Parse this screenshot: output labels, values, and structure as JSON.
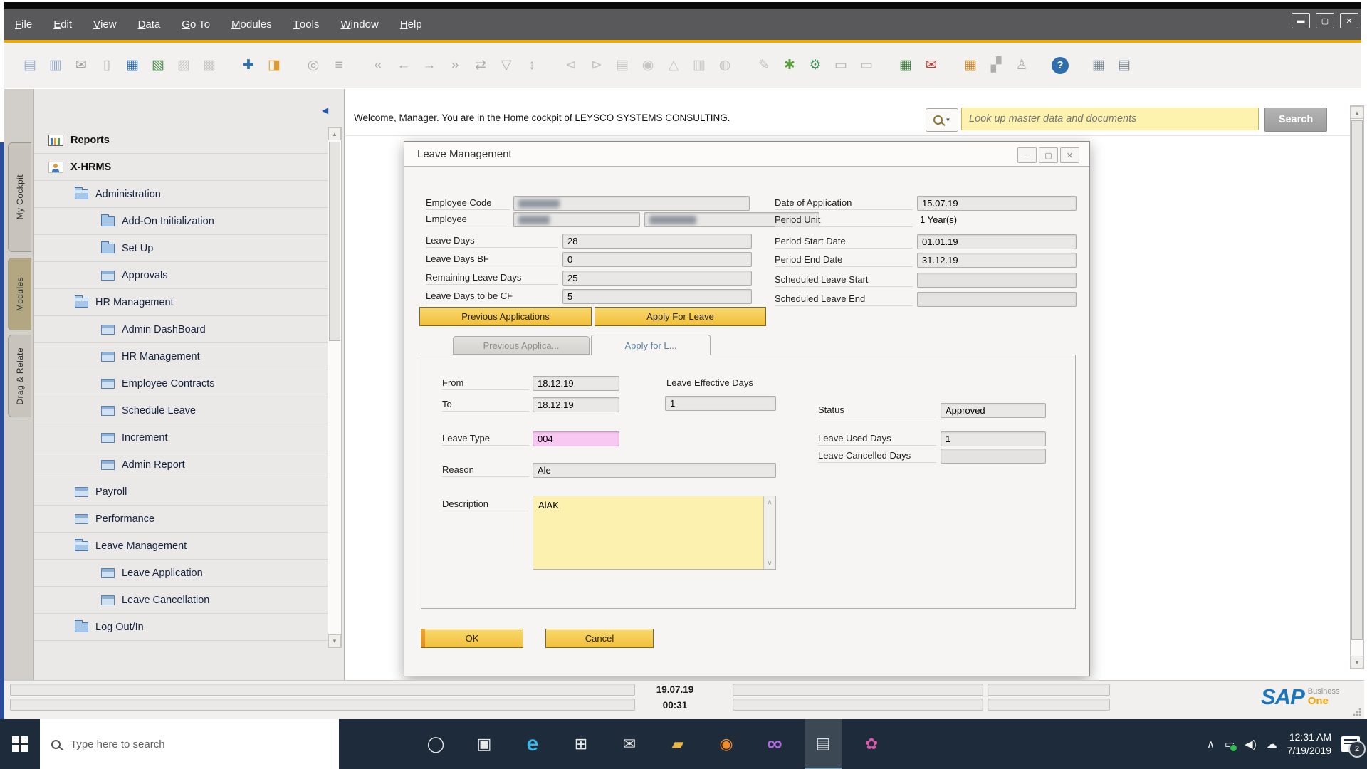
{
  "colors": {
    "accent_gold": "#F0AB00",
    "sap_blue": "#1B74BC",
    "sap_one_orange": "#F0A500",
    "leave_type_pink": "#F9C8F2",
    "description_yellow": "#FCF1AE",
    "search_yellow": "#FDF2AE",
    "menubar_gray": "#59595B",
    "taskbar_navy": "#1E2B3A"
  },
  "menu_bar": {
    "items": [
      {
        "label": "File"
      },
      {
        "label": "Edit"
      },
      {
        "label": "View"
      },
      {
        "label": "Data"
      },
      {
        "label": "Go To"
      },
      {
        "label": "Modules"
      },
      {
        "label": "Tools"
      },
      {
        "label": "Window"
      },
      {
        "label": "Help"
      }
    ]
  },
  "window_controls": {
    "minimize": "▬",
    "restore": "▢",
    "close": "✕"
  },
  "toolbar": {
    "icons": [
      {
        "name": "print-preview",
        "glyph": "▤",
        "color": "#9ab0cc"
      },
      {
        "name": "print",
        "glyph": "▥",
        "color": "#8aa0bc"
      },
      {
        "name": "email",
        "glyph": "✉",
        "color": "#a8a6a2"
      },
      {
        "name": "copy-document",
        "glyph": "▯",
        "color": "#b8b6b2"
      },
      {
        "name": "fax",
        "glyph": "▦",
        "color": "#2f6fae"
      },
      {
        "name": "export-excel",
        "glyph": "▧",
        "color": "#4e8f4e"
      },
      {
        "name": "export-word",
        "glyph": "▨",
        "color": "#c6c4c0"
      },
      {
        "name": "export-pdf",
        "glyph": "▩",
        "color": "#c6c4c0"
      },
      {
        "name": "navigation-arrows",
        "glyph": "✚",
        "color": "#2f6fae",
        "gap": true
      },
      {
        "name": "lock-screen",
        "glyph": "◨",
        "color": "#e09a2f"
      },
      {
        "name": "find",
        "glyph": "◎",
        "color": "#b0aeaa",
        "gap": true
      },
      {
        "name": "list-view",
        "glyph": "≡",
        "color": "#b0aeaa"
      },
      {
        "name": "first-record",
        "glyph": "«",
        "color": "#b0aeaa",
        "gap": true
      },
      {
        "name": "previous-record",
        "glyph": "←",
        "color": "#b0aeaa"
      },
      {
        "name": "next-record",
        "glyph": "→",
        "color": "#b0aeaa"
      },
      {
        "name": "last-record",
        "glyph": "»",
        "color": "#b0aeaa"
      },
      {
        "name": "refresh",
        "glyph": "⇄",
        "color": "#b0aeaa"
      },
      {
        "name": "filter",
        "glyph": "▽",
        "color": "#b0aeaa"
      },
      {
        "name": "sort",
        "glyph": "↕",
        "color": "#b0aeaa"
      },
      {
        "name": "copy-from",
        "glyph": "⊲",
        "color": "#c6c4c0",
        "gap": true
      },
      {
        "name": "copy-to",
        "glyph": "⊳",
        "color": "#c6c4c0"
      },
      {
        "name": "payment-means",
        "glyph": "▤",
        "color": "#c6c4c0"
      },
      {
        "name": "money-functions",
        "glyph": "◉",
        "color": "#c6c4c0"
      },
      {
        "name": "volume-weight",
        "glyph": "△",
        "color": "#c6c4c0"
      },
      {
        "name": "journal-entry",
        "glyph": "▥",
        "color": "#c6c4c0"
      },
      {
        "name": "document-search",
        "glyph": "◍",
        "color": "#c6c4c0"
      },
      {
        "name": "edit",
        "glyph": "✎",
        "color": "#c6c4c0",
        "gap": true
      },
      {
        "name": "new-activity",
        "glyph": "✱",
        "color": "#5a9e3f"
      },
      {
        "name": "settings-wrench",
        "glyph": "⚙",
        "color": "#3f8f5a"
      },
      {
        "name": "remarks",
        "glyph": "▭",
        "color": "#b0aeaa"
      },
      {
        "name": "delivery-note",
        "glyph": "▭",
        "color": "#b0aeaa"
      },
      {
        "name": "checklist",
        "glyph": "▦",
        "color": "#3f7d3f",
        "gap": true
      },
      {
        "name": "mail-alert",
        "glyph": "✉",
        "color": "#c03a2f"
      },
      {
        "name": "report-designer",
        "glyph": "▦",
        "color": "#c98a2f",
        "gap": true
      },
      {
        "name": "org-chart",
        "glyph": "▞",
        "color": "#b0aeaa"
      },
      {
        "name": "user",
        "glyph": "♙",
        "color": "#b0aeaa"
      },
      {
        "name": "help",
        "glyph": "?",
        "color": "#2f6fae",
        "circle": true,
        "gap": true
      },
      {
        "name": "calculator",
        "glyph": "▦",
        "color": "#7a8894",
        "gap": true
      },
      {
        "name": "keyboard-calc",
        "glyph": "▤",
        "color": "#7a8894"
      }
    ]
  },
  "sidebar": {
    "tabs": [
      {
        "label": "My Cockpit"
      },
      {
        "label": "Modules"
      },
      {
        "label": "Drag & Relate"
      }
    ],
    "tree": [
      {
        "label": "Reports",
        "icon": "chart",
        "level": 0,
        "bold": true
      },
      {
        "label": "X-HRMS",
        "icon": "person",
        "level": 0,
        "bold": true
      },
      {
        "label": "Administration",
        "icon": "folder-open",
        "level": 1,
        "bold": false
      },
      {
        "label": "Add-On Initialization",
        "icon": "folder",
        "level": 2,
        "bold": false
      },
      {
        "label": "Set Up",
        "icon": "folder",
        "level": 2,
        "bold": false
      },
      {
        "label": "Approvals",
        "icon": "window",
        "level": 2,
        "bold": false
      },
      {
        "label": "HR Management",
        "icon": "folder-open",
        "level": 1,
        "bold": false
      },
      {
        "label": "Admin DashBoard",
        "icon": "window",
        "level": 2,
        "bold": false
      },
      {
        "label": "HR Management",
        "icon": "window",
        "level": 2,
        "bold": false
      },
      {
        "label": "Employee Contracts",
        "icon": "window",
        "level": 2,
        "bold": false
      },
      {
        "label": "Schedule Leave",
        "icon": "window",
        "level": 2,
        "bold": false
      },
      {
        "label": "Increment",
        "icon": "window",
        "level": 2,
        "bold": false
      },
      {
        "label": "Admin Report",
        "icon": "window",
        "level": 2,
        "bold": false
      },
      {
        "label": "Payroll",
        "icon": "window",
        "level": 1,
        "bold": false
      },
      {
        "label": "Performance",
        "icon": "window",
        "level": 1,
        "bold": false
      },
      {
        "label": "Leave Management",
        "icon": "folder-open",
        "level": 1,
        "bold": false
      },
      {
        "label": "Leave Application",
        "icon": "window",
        "level": 2,
        "bold": false
      },
      {
        "label": "Leave Cancellation",
        "icon": "window",
        "level": 2,
        "bold": false
      },
      {
        "label": "Log Out/In",
        "icon": "folder",
        "level": 1,
        "bold": false
      }
    ]
  },
  "content": {
    "welcome_text": "Welcome, Manager. You are in the Home cockpit of LEYSCO SYSTEMS CONSULTING.",
    "search": {
      "placeholder": "Look up master data and documents",
      "button_label": "Search"
    }
  },
  "dialog": {
    "title": "Leave Management",
    "fields": {
      "employee_code_label": "Employee Code",
      "employee_label": "Employee",
      "leave_days_label": "Leave Days",
      "leave_days_value": "28",
      "leave_days_bf_label": "Leave Days BF",
      "leave_days_bf_value": "0",
      "remaining_leave_days_label": "Remaining Leave Days",
      "remaining_leave_days_value": "25",
      "leave_days_cf_label": "Leave Days to be CF",
      "leave_days_cf_value": "5",
      "date_of_application_label": "Date of Application",
      "date_of_application_value": "15.07.19",
      "period_unit_label": "Period Unit",
      "period_unit_value": "1 Year(s)",
      "period_start_label": "Period Start Date",
      "period_start_value": "01.01.19",
      "period_end_label": "Period End Date",
      "period_end_value": "31.12.19",
      "scheduled_start_label": "Scheduled Leave Start",
      "scheduled_start_value": "",
      "scheduled_end_label": "Scheduled Leave End",
      "scheduled_end_value": ""
    },
    "action_buttons": {
      "previous_applications": "Previous Applications",
      "apply_for_leave": "Apply For Leave"
    },
    "tabs": {
      "previous": "Previous Applica...",
      "apply": "Apply for L..."
    },
    "form": {
      "from_label": "From",
      "from_value": "18.12.19",
      "to_label": "To",
      "to_value": "18.12.19",
      "leave_effective_days_label": "Leave Effective Days",
      "leave_effective_days_value": "1",
      "leave_type_label": "Leave Type",
      "leave_type_value": "004",
      "reason_label": "Reason",
      "reason_value": "Ale",
      "description_label": "Description",
      "description_value": "AlAK",
      "status_label": "Status",
      "status_value": "Approved",
      "leave_used_days_label": "Leave Used Days",
      "leave_used_days_value": "1",
      "leave_cancelled_days_label": "Leave Cancelled Days",
      "leave_cancelled_days_value": ""
    },
    "footer_buttons": {
      "ok": "OK",
      "cancel": "Cancel"
    }
  },
  "status_bar": {
    "date": "19.07.19",
    "time": "00:31",
    "sap_logo": {
      "sap": "SAP",
      "business": "Business",
      "one": "One"
    }
  },
  "taskbar": {
    "search_placeholder": "Type here to search",
    "apps": [
      {
        "name": "cortana",
        "glyph": "◯",
        "color": "#e8e8e8"
      },
      {
        "name": "task-view",
        "glyph": "▣",
        "color": "#e8e8e8"
      },
      {
        "name": "edge",
        "glyph": "e",
        "color": "#3fb6e8",
        "big": true
      },
      {
        "name": "store",
        "glyph": "⊞",
        "color": "#eaeaea"
      },
      {
        "name": "mail",
        "glyph": "✉",
        "color": "#eaeaea"
      },
      {
        "name": "file-explorer",
        "glyph": "▰",
        "color": "#e8b54a"
      },
      {
        "name": "firefox",
        "glyph": "◉",
        "color": "#f28c28"
      },
      {
        "name": "infinity-app",
        "glyph": "∞",
        "color": "#b06ae0",
        "big": true
      },
      {
        "name": "sap-business-one",
        "glyph": "▤",
        "color": "#dfe7ee",
        "active": true
      },
      {
        "name": "paint",
        "glyph": "✿",
        "color": "#d957a8"
      }
    ],
    "tray": {
      "icons": [
        {
          "name": "tray-expand",
          "glyph": "∧"
        },
        {
          "name": "battery",
          "glyph": "▭"
        },
        {
          "name": "volume",
          "glyph": "◀)"
        },
        {
          "name": "onedrive",
          "glyph": "☁"
        }
      ],
      "clock_time": "12:31 AM",
      "clock_date": "7/19/2019",
      "notification_count": "2"
    }
  }
}
